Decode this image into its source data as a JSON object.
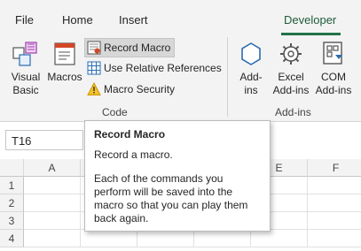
{
  "tabs": [
    {
      "label": "File"
    },
    {
      "label": "Home"
    },
    {
      "label": "Insert"
    },
    {
      "label": "Developer"
    }
  ],
  "code_group": {
    "label": "Code",
    "visual_basic": "Visual\nBasic",
    "macros": "Macros",
    "record_macro": "Record Macro",
    "relative_refs": "Use Relative References",
    "macro_security": "Macro Security"
  },
  "addins_group": {
    "label": "Add-ins",
    "addins": "Add-\nins",
    "excel_addins": "Excel\nAdd-ins",
    "com_addins": "COM\nAdd-ins"
  },
  "name_box": "T16",
  "columns": [
    "A",
    "E",
    "F"
  ],
  "rows": [
    "1",
    "2",
    "3",
    "4"
  ],
  "tooltip": {
    "title": "Record Macro",
    "subtitle": "Record a macro.",
    "body": "Each of the commands you perform will be saved into the macro so that you can play them back again."
  },
  "colors": {
    "accent": "#217346",
    "ribbon_bg": "#f3f3f3"
  }
}
